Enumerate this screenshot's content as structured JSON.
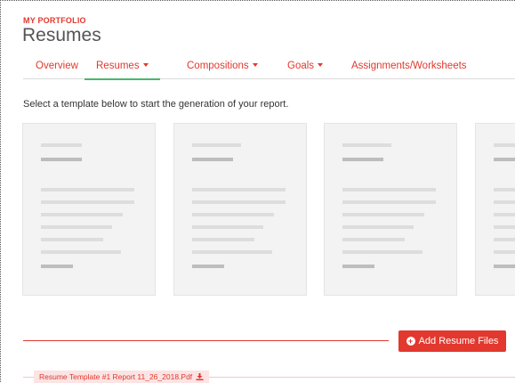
{
  "header": {
    "eyebrow": "MY PORTFOLIO",
    "title": "Resumes"
  },
  "tabs": [
    {
      "label": "Overview",
      "dropdown": false,
      "active": false
    },
    {
      "label": "Resumes",
      "dropdown": true,
      "active": true
    },
    {
      "label": "Compositions",
      "dropdown": true,
      "active": false
    },
    {
      "label": "Goals",
      "dropdown": true,
      "active": false
    },
    {
      "label": "Assignments/Worksheets",
      "dropdown": false,
      "active": false
    }
  ],
  "intro_text": "Select a template below to start the generation of your report.",
  "templates_count_visible": 4,
  "actions": {
    "add_files_label": "Add Resume Files",
    "add_icon": "plus-circle-icon"
  },
  "files": [
    {
      "name": "Resume Template #1 Report 11_26_2018.Pdf",
      "icon": "download-icon"
    }
  ],
  "colors": {
    "accent": "#e2382e",
    "active_tab_underline": "#48b66b",
    "card_bg": "#f3f3f3"
  }
}
